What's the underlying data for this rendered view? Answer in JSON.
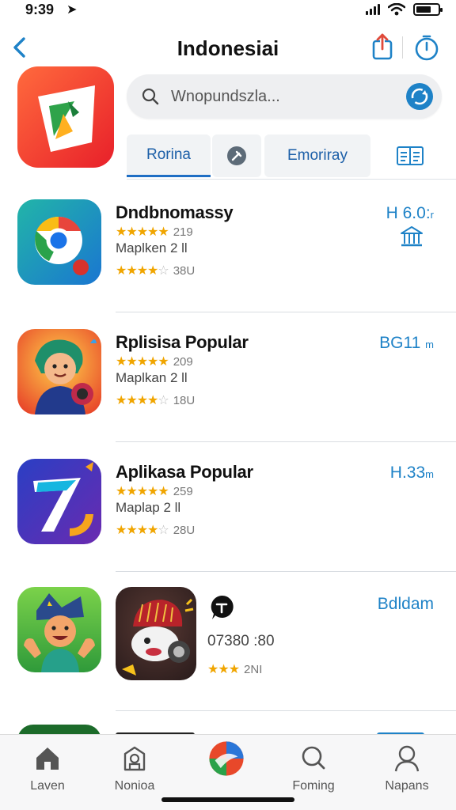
{
  "status_bar": {
    "time": "9:39",
    "location_arrow": "➤"
  },
  "header": {
    "title": "Indonesiai",
    "back_icon": "chevron-left-icon",
    "share_icon": "share-icon",
    "timer_icon": "timer-icon"
  },
  "search": {
    "placeholder": "Wnopundszla..."
  },
  "tabs": [
    {
      "label": "Rorina",
      "active": true
    },
    {
      "label": "",
      "icon": "pin-icon"
    },
    {
      "label": "Emoriray"
    },
    {
      "label": "",
      "icon": "grid-icon"
    }
  ],
  "apps": [
    {
      "title": "Dndbnomassy",
      "stars_top": "★★★★★",
      "count_top": "219",
      "sub": "Maplken 2 ll",
      "stars_bottom": "★★★★",
      "stars_bottom_empty": "☆",
      "count_bottom": "38U",
      "price": "H 6.0:",
      "price_unit": "r"
    },
    {
      "title": "Rplisisa Popular",
      "stars_top": "★★★★★",
      "count_top": "209",
      "sub": "Maplkan 2 ll",
      "stars_bottom": "★★★★",
      "stars_bottom_empty": "☆",
      "count_bottom": "18U",
      "price": "BG11",
      "price_unit": "m"
    },
    {
      "title": "Aplikasa Popular",
      "stars_top": "★★★★★",
      "count_top": "259",
      "sub": "Maplap 2 ll",
      "stars_bottom": "★★★★",
      "stars_bottom_empty": "☆",
      "count_bottom": "28U",
      "price": "H.33",
      "price_unit": "m"
    },
    {
      "mid_value": "07380 :80",
      "stars": "★★★",
      "rating_count": "2NI",
      "price": "Bdldam"
    }
  ],
  "tabbar": [
    {
      "label": "Laven",
      "icon": "home-icon"
    },
    {
      "label": "Nonioa",
      "icon": "box-icon"
    },
    {
      "label": "",
      "icon": "app-store-logo-icon"
    },
    {
      "label": "Foming",
      "icon": "search-icon"
    },
    {
      "label": "Napans",
      "icon": "person-icon"
    }
  ],
  "colors": {
    "accent": "#1e82c7",
    "star": "#f0a500",
    "tab_text": "#1c5fa8"
  }
}
